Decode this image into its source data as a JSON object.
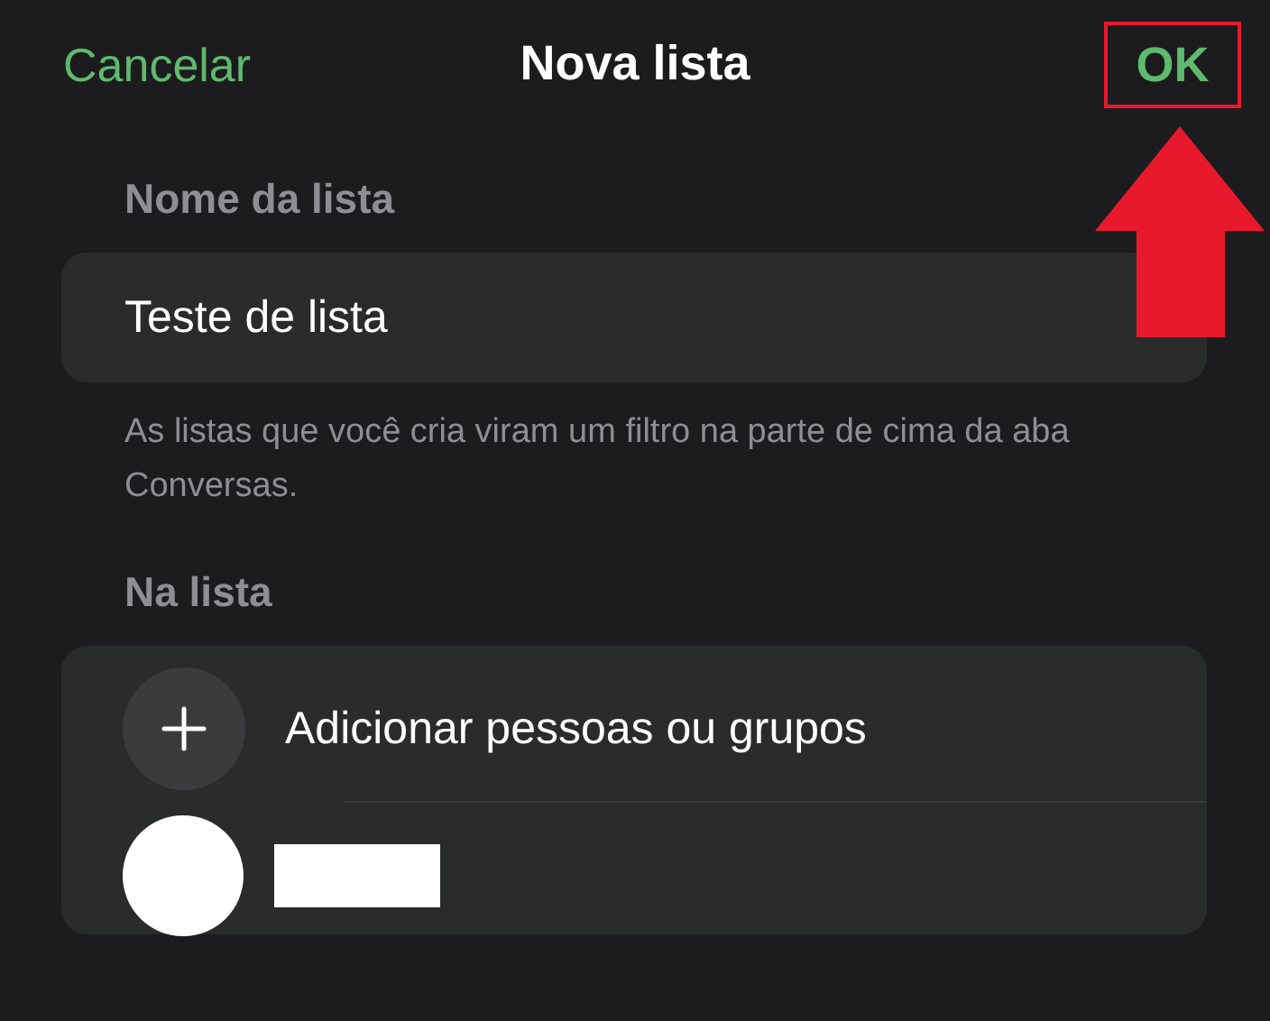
{
  "nav": {
    "cancel": "Cancelar",
    "title": "Nova lista",
    "confirm": "OK",
    "confirm_highlighted": true
  },
  "name_section": {
    "label": "Nome da lista",
    "value": "Teste de lista",
    "hint": "As listas que você cria viram um filtro na parte de cima da aba Conversas."
  },
  "members_section": {
    "label": "Na lista",
    "add_label": "Adicionar pessoas ou grupos",
    "members": [
      {
        "kind": "redacted"
      }
    ]
  }
}
